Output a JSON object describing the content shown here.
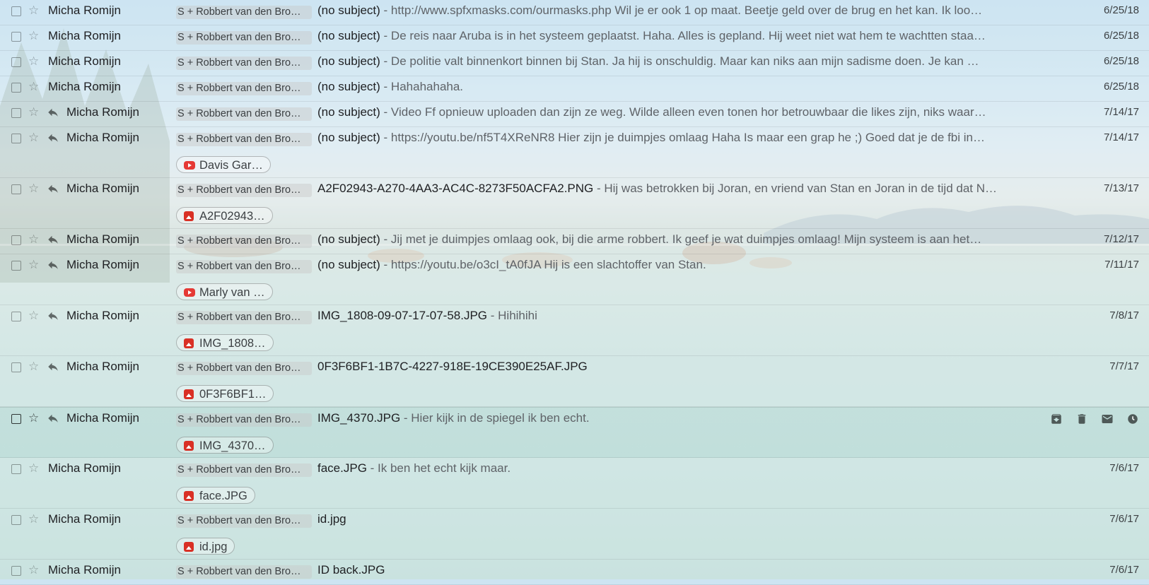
{
  "theme": {
    "sky": "#aed4ea",
    "water": "#b4d8d4",
    "attachment_icon": "#d93025"
  },
  "icons": {
    "checkbox": "checkbox-icon",
    "star": "star-icon",
    "replied": "reply-icon",
    "image": "image-icon",
    "youtube": "youtube-icon"
  },
  "hover_actions": [
    "archive-icon",
    "trash-icon",
    "mark-unread-icon",
    "snooze-icon"
  ],
  "emails": [
    {
      "sender": "Micha Romijn",
      "replied": false,
      "label": "S + Robbert van den Bro…",
      "subject": "(no subject)",
      "snippet": " - http://www.spfxmasks.com/ourmasks.php Wil je er ook 1 op maat. Beetje geld over de brug en het kan. Ik loo…",
      "date": "6/25/18"
    },
    {
      "sender": "Micha Romijn",
      "replied": false,
      "label": "S + Robbert van den Bro…",
      "subject": "(no subject)",
      "snippet": " - De reis naar Aruba is in het systeem geplaatst. Haha. Alles is gepland. Hij weet niet wat hem te wachtten staa…",
      "date": "6/25/18"
    },
    {
      "sender": "Micha Romijn",
      "replied": false,
      "label": "S + Robbert van den Bro…",
      "subject": "(no subject)",
      "snippet": " - De politie valt binnenkort binnen bij Stan. Ja hij is onschuldig. Maar kan niks aan mijn sadisme doen. Je kan …",
      "date": "6/25/18"
    },
    {
      "sender": "Micha Romijn",
      "replied": false,
      "label": "S + Robbert van den Bro…",
      "subject": "(no subject)",
      "snippet": " - Hahahahaha.",
      "date": "6/25/18"
    },
    {
      "sender": "Micha Romijn",
      "replied": true,
      "label": "S + Robbert van den Bro…",
      "subject": "(no subject)",
      "snippet": " - Video Ff opnieuw uploaden dan zijn ze weg. Wilde alleen even tonen hor betrouwbaar die likes zijn, niks waar…",
      "date": "7/14/17"
    },
    {
      "sender": "Micha Romijn",
      "replied": true,
      "label": "S + Robbert van den Bro…",
      "subject": "(no subject)",
      "snippet": " - https://youtu.be/nf5T4XReNR8 Hier zijn je duimpjes omlaag Haha Is maar een grap he ;) Goed dat je de fbi in…",
      "date": "7/14/17",
      "attachment": {
        "type": "youtube",
        "name": "Davis Gar…"
      }
    },
    {
      "sender": "Micha Romijn",
      "replied": true,
      "label": "S + Robbert van den Bro…",
      "subject": "A2F02943-A270-4AA3-AC4C-8273F50ACFA2.PNG",
      "snippet": " - Hij was betrokken bij Joran, en vriend van Stan en Joran in de tijd dat N…",
      "date": "7/13/17",
      "attachment": {
        "type": "image",
        "name": "A2F02943…"
      }
    },
    {
      "sender": "Micha Romijn",
      "replied": true,
      "label": "S + Robbert van den Bro…",
      "subject": "(no subject)",
      "snippet": " - Jij met je duimpjes omlaag ook, bij die arme robbert. Ik geef je wat duimpjes omlaag! Mijn systeem is aan het…",
      "date": "7/12/17"
    },
    {
      "sender": "Micha Romijn",
      "replied": true,
      "label": "S + Robbert van den Bro…",
      "subject": "(no subject)",
      "snippet": " - https://youtu.be/o3cI_tA0fJA Hij is een slachtoffer van Stan.",
      "date": "7/11/17",
      "attachment": {
        "type": "youtube",
        "name": "Marly van …"
      }
    },
    {
      "sender": "Micha Romijn",
      "replied": true,
      "label": "S + Robbert van den Bro…",
      "subject": "IMG_1808-09-07-17-07-58.JPG",
      "snippet": " - Hihihihi",
      "date": "7/8/17",
      "attachment": {
        "type": "image",
        "name": "IMG_1808…"
      }
    },
    {
      "sender": "Micha Romijn",
      "replied": true,
      "label": "S + Robbert van den Bro…",
      "subject": "0F3F6BF1-1B7C-4227-918E-19CE390E25AF.JPG",
      "snippet": "",
      "date": "7/7/17",
      "attachment": {
        "type": "image",
        "name": "0F3F6BF1…"
      }
    },
    {
      "sender": "Micha Romijn",
      "replied": true,
      "label": "S + Robbert van den Bro…",
      "subject": "IMG_4370.JPG",
      "snippet": " - Hier kijk in de spiegel ik ben echt.",
      "date": "",
      "hover": true,
      "attachment": {
        "type": "image",
        "name": "IMG_4370…"
      }
    },
    {
      "sender": "Micha Romijn",
      "replied": false,
      "label": "S + Robbert van den Bro…",
      "subject": "face.JPG",
      "snippet": " - Ik ben het echt kijk maar.",
      "date": "7/6/17",
      "attachment": {
        "type": "image",
        "name": "face.JPG"
      }
    },
    {
      "sender": "Micha Romijn",
      "replied": false,
      "label": "S + Robbert van den Bro…",
      "subject": "id.jpg",
      "snippet": "",
      "date": "7/6/17",
      "attachment": {
        "type": "image",
        "name": "id.jpg"
      }
    },
    {
      "sender": "Micha Romijn",
      "replied": false,
      "label": "S + Robbert van den Bro…",
      "subject": "ID back.JPG",
      "snippet": "",
      "date": "7/6/17"
    }
  ]
}
